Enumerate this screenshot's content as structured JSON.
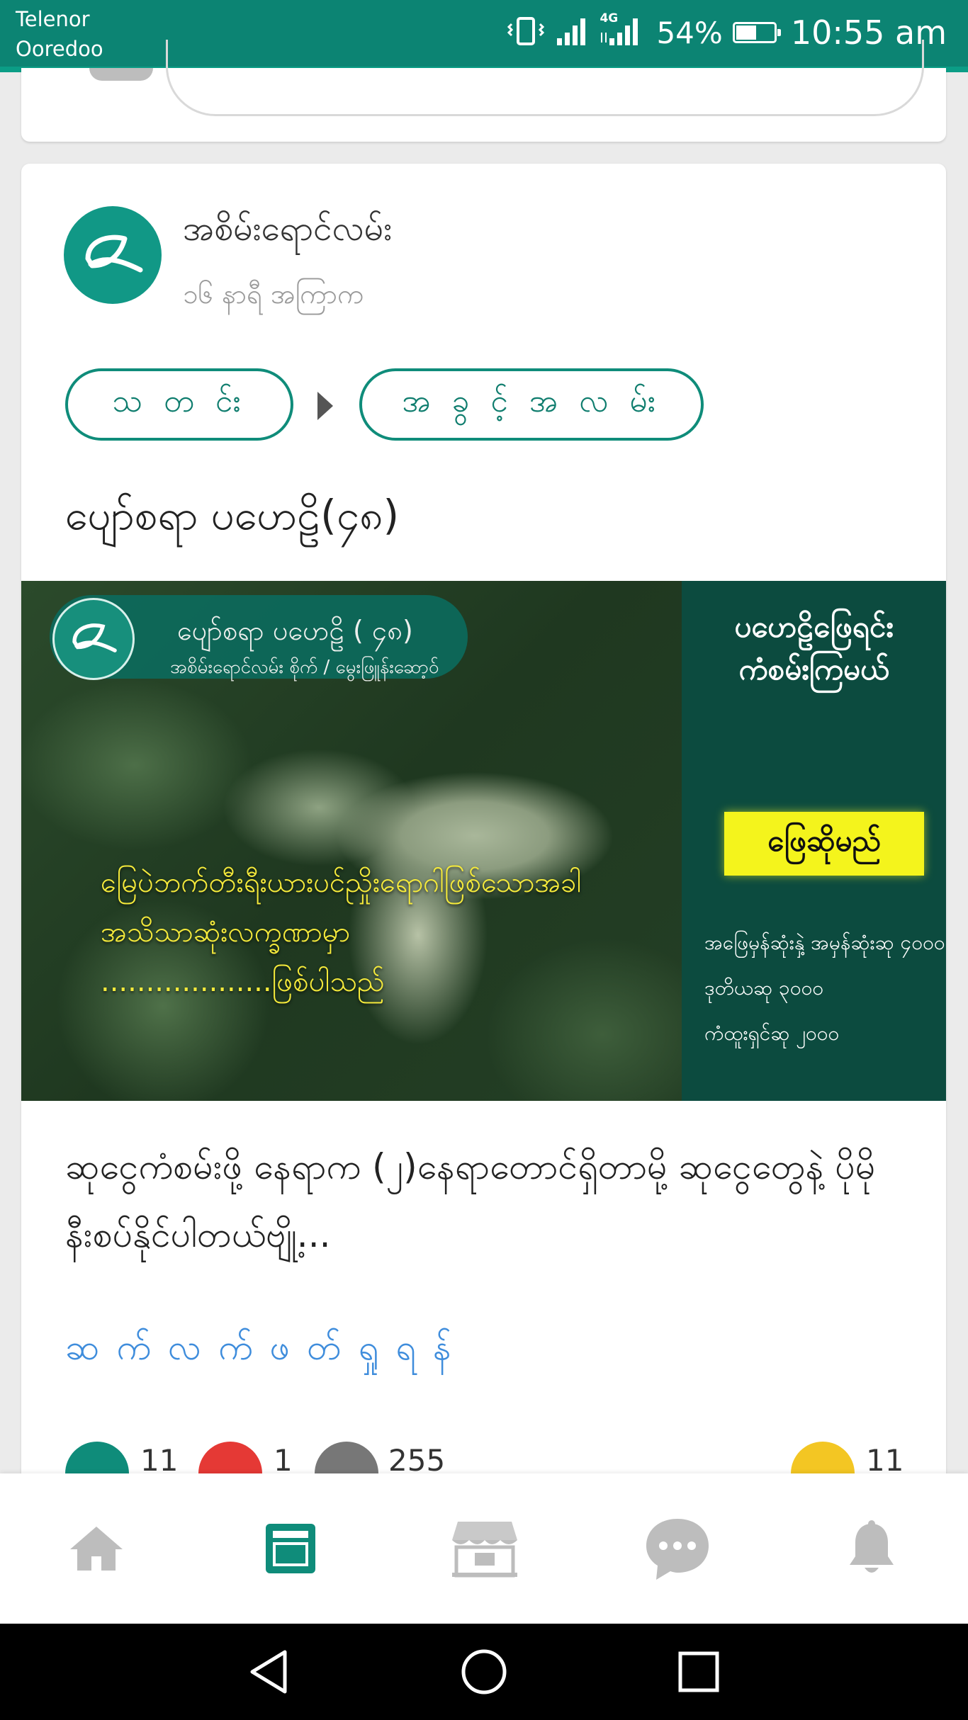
{
  "status_bar": {
    "carrier_1": "Telenor",
    "carrier_2": "Ooredoo",
    "network": "4G",
    "battery": "54%",
    "battery_level": 0.54,
    "time": "10:55 am"
  },
  "post": {
    "author": "အစိမ်းရောင်လမ်း",
    "time_ago": "၁၆ နာရီ အကြာက",
    "tags": [
      "သ တ င်း",
      "အ ခွ င့် အ လ မ်း"
    ],
    "title": "ပျော်စရာ ပဟေဠိ(၄၈)",
    "banner": {
      "ribbon_title": "ပျော်စရာ ပဟေဠိ ( ၄၈)",
      "ribbon_subtitle": "အစိမ်းရောင်လမ်း စိုက် / မွေးဖြူန်းဆော့ဝ်",
      "overlay_line_1": "မြေပဲဘက်တီးရီးယားပင်ညှိုးရောဂါဖြစ်သောအခါ",
      "overlay_line_2": "အသိသာဆုံးလက္ခဏာမှာ",
      "overlay_line_3": "...................ဖြစ်ပါသည်",
      "side_heading_1": "ပဟေဠိဖြေရင်း",
      "side_heading_2": "ကံစမ်းကြမယ်",
      "answer_button": "ဖြေဆိုမည်",
      "prize_1": "အဖြေမှန်ဆုံးနှဲ့ အမှန်ဆုံးဆု ၄၀၀၀",
      "prize_2": "ဒုတိယဆု ၃၀၀၀",
      "prize_3": "ကံထူးရှင်ဆု ၂၀၀၀"
    },
    "body": "ဆုငွေကံစမ်းဖို့ နေရာက (၂)နေရာတောင်ရှိတာမို့ ဆုငွေတွေနဲ့ ပိုမိုနီးစပ်နိုင်ပါတယ်ဗျို့...",
    "read_more": "ဆ က် လ က် ဖ တ် ရှု ရ န်",
    "reactions": {
      "likes": "11",
      "loves": "1",
      "views": "255",
      "saves": "11"
    }
  },
  "bottom_nav": {
    "items": [
      "home-icon",
      "newsfeed-icon",
      "shop-icon",
      "chat-icon",
      "bell-icon"
    ],
    "active_color": "#0f8c7a",
    "inactive_color": "#bdbdbd"
  },
  "colors": {
    "status_bar": "#0c8473",
    "brand": "#119886",
    "link": "#3f8ddc"
  }
}
